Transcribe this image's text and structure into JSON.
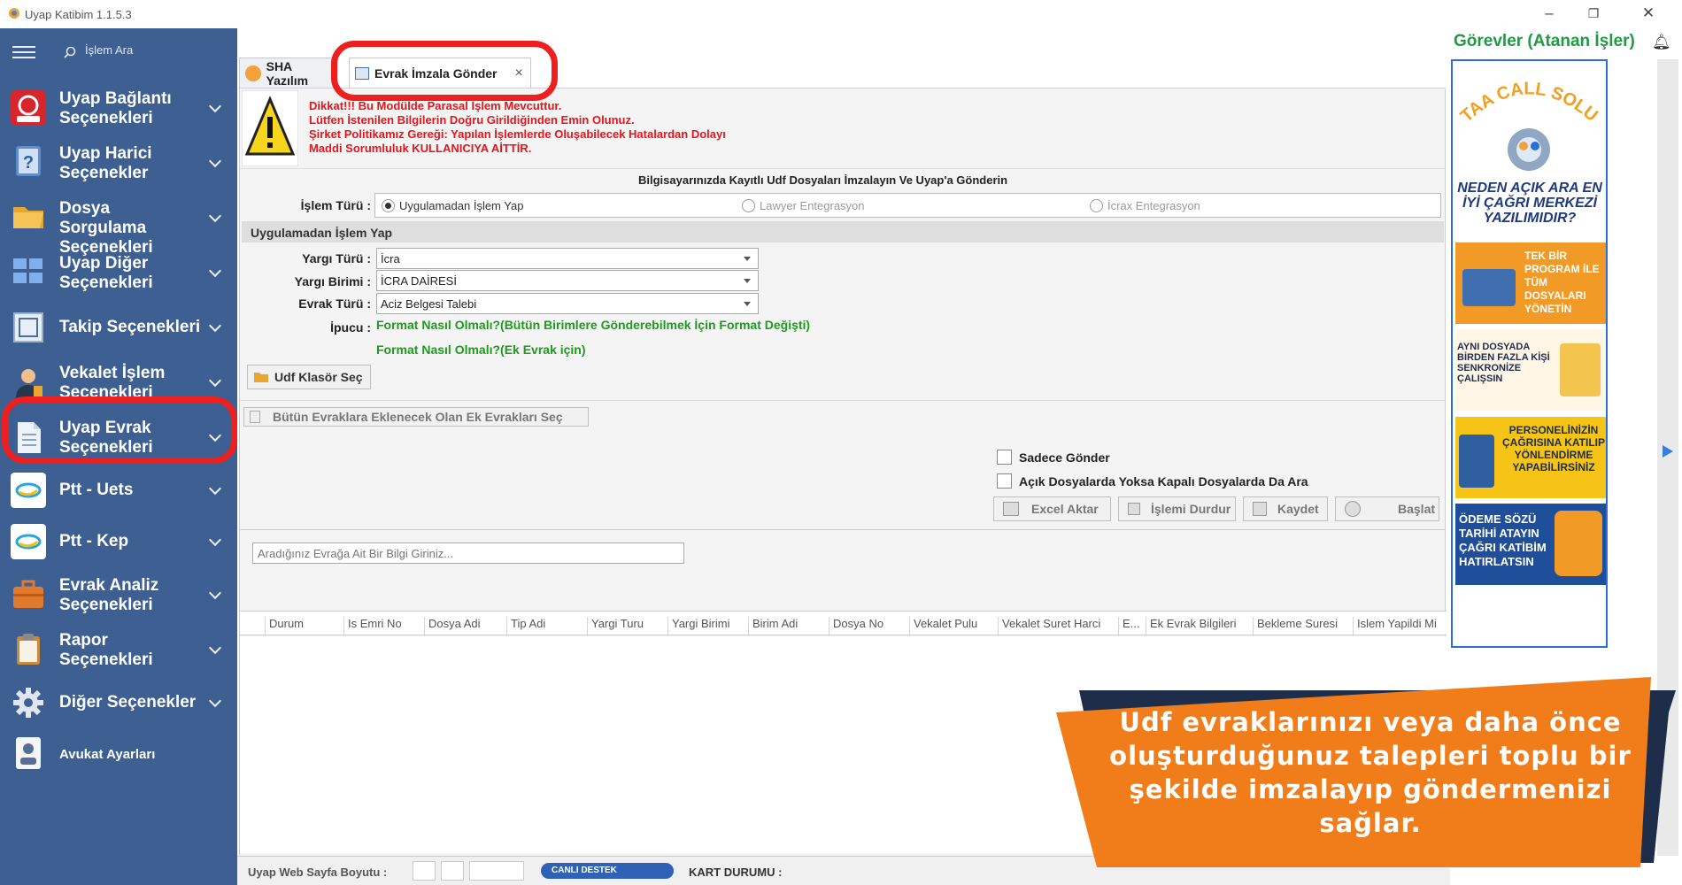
{
  "app": {
    "title": "Uyap Katibim 1.1.5.3"
  },
  "sidebar": {
    "search_placeholder": "İşlem Ara",
    "items": [
      {
        "label": "Uyap Bağlantı Seçenekleri",
        "icon": "uyap-logo-icon"
      },
      {
        "label": "Uyap Harici Seçenekler",
        "icon": "help-book-icon"
      },
      {
        "label": "Dosya Sorgulama Seçenekleri",
        "icon": "folder-icon"
      },
      {
        "label": "Uyap Diğer Seçenekleri",
        "icon": "grid-icon"
      },
      {
        "label": "Takip Seçenekleri",
        "icon": "frame-icon"
      },
      {
        "label": "Vekalet İşlem Seçenekleri",
        "icon": "person-icon"
      },
      {
        "label": "Uyap Evrak Seçenekleri",
        "icon": "document-icon"
      },
      {
        "label": "Ptt - Uets",
        "icon": "ptt-icon"
      },
      {
        "label": "Ptt - Kep",
        "icon": "ptt-icon"
      },
      {
        "label": "Evrak Analiz Seçenekleri",
        "icon": "briefcase-icon"
      },
      {
        "label": "Rapor Seçenekleri",
        "icon": "clipboard-icon"
      },
      {
        "label": "Diğer Seçenekler",
        "icon": "gear-icon"
      },
      {
        "label": "Avukat Ayarları",
        "icon": "user-card-icon"
      }
    ]
  },
  "tabs": [
    {
      "label": "SHA Yazılım",
      "active": false
    },
    {
      "label": "Evrak İmzala Gönder",
      "active": true,
      "close": "×"
    }
  ],
  "warning": {
    "lines": [
      "Dikkat!!! Bu Modülde Parasal İşlem Mevcuttur.",
      "Lütfen İstenilen Bilgilerin Doğru Girildiğinden Emin Olunuz.",
      "Şirket Politikamız Gereği: Yapılan İşlemlerde Oluşabilecek Hatalardan Dolayı",
      "Maddi Sorumluluk KULLANICIYA AİTTİR."
    ]
  },
  "form": {
    "heading": "Bilgisayarınızda Kayıtlı Udf Dosyaları İmzalayın Ve Uyap'a Gönderin",
    "islem_turu_label": "İşlem Türü :",
    "radios": [
      {
        "label": "Uygulamadan İşlem Yap",
        "selected": true
      },
      {
        "label": "Lawyer Entegrasyon",
        "selected": false
      },
      {
        "label": "İcrax Entegrasyon",
        "selected": false
      }
    ],
    "section_title": "Uygulamadan İşlem Yap",
    "yargi_turu_label": "Yargı Türü :",
    "yargi_turu_value": "İcra",
    "yargi_birimi_label": "Yargı Birimi :",
    "yargi_birimi_value": "İCRA DAİRESİ",
    "evrak_turu_label": "Evrak Türü :",
    "evrak_turu_value": "Aciz Belgesi Talebi",
    "ipucu_label": "İpucu :",
    "hint1": "Format Nasıl Olmalı?(Bütün Birimlere Gönderebilmek İçin Format Değişti)",
    "hint2": "Format Nasıl Olmalı?(Ek Evrak için)",
    "udf_btn": "Udf Klasör Seç",
    "ek_btn": "Bütün Evraklara Eklenecek Olan Ek Evrakları Seç",
    "chk_sadece": "Sadece Gönder",
    "chk_acik": "Açık Dosyalarda Yoksa Kapalı Dosyalarda Da Ara",
    "btn_excel": "Excel Aktar",
    "btn_durdur": "İşlemi Durdur",
    "btn_kaydet": "Kaydet",
    "btn_basla": "Başlat",
    "search_placeholder": "Aradığınız Evrağa Ait Bir Bilgi Giriniz..."
  },
  "grid": {
    "columns": [
      "Durum",
      "Is Emri No",
      "Dosya Adi",
      "Tip Adi",
      "Yargi Turu",
      "Yargi Birimi",
      "Birim Adi",
      "Dosya No",
      "Vekalet Pulu",
      "Vekalet Suret Harci",
      "E...",
      "Ek Evrak Bilgileri",
      "Bekleme Suresi",
      "Islem Yapildi Mi"
    ]
  },
  "status": {
    "web_size_label": "Uyap Web Sayfa Boyutu :",
    "canli_destek": "CANLI DESTEK",
    "kart_durumu": "KART DURUMU :"
  },
  "right_panel": {
    "title": "Görevler (Atanan İşler)",
    "ad": {
      "brand": "TAA CALL SOLUTION",
      "headline": "NEDEN AÇIK ARA EN İYİ ÇAĞRI MERKEZİ YAZILIMIDIR?",
      "b1": "TEK BİR PROGRAM İLE TÜM DOSYALARI YÖNETİN",
      "b2": "AYNI DOSYADA BİRDEN FAZLA KİŞİ SENKRONİZE ÇALIŞSIN",
      "b3": "PERSONELİNİZİN ÇAĞRISINA KATILIP YÖNLENDİRME YAPABİLİRSİNİZ",
      "b4": "ÖDEME SÖZÜ TARİHİ ATAYIN ÇAĞRI KATİBİM HATIRLATSIN"
    }
  },
  "banner": {
    "text": "Udf evraklarınızı veya daha önce oluşturduğunuz talepleri toplu bir şekilde imzalayıp göndermenizi sağlar."
  },
  "colors": {
    "sidebar": "#3d5f92",
    "highlight_ring": "#ee1f1f",
    "banner_orange": "#f07d1a",
    "banner_navy": "#1e2d4a",
    "warning_red": "#e8141c",
    "hint_green": "#1e9a1e"
  }
}
